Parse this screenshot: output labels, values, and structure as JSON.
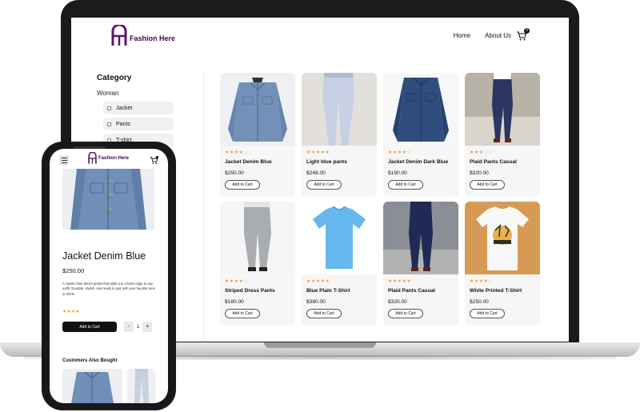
{
  "brand": {
    "name": "Fashion Here",
    "primary_color": "#3a0a4a",
    "accent_color": "#e6a23c"
  },
  "nav": {
    "links": [
      "Home",
      "About Us"
    ],
    "cart_count": "0"
  },
  "sidebar": {
    "title": "Category",
    "group": "Woman",
    "items": [
      "Jacket",
      "Pants",
      "T-shirt"
    ]
  },
  "products": [
    {
      "name": "Jacket Denim Blue",
      "price": "$250.00",
      "rating": 4,
      "button": "Add to Cart",
      "image": "denim-jacket-light"
    },
    {
      "name": "Light blue pants",
      "price": "$248.00",
      "rating": 5,
      "button": "Add to Cart",
      "image": "light-blue-pants"
    },
    {
      "name": "Jacket Denim Dark Blue",
      "price": "$190.00",
      "rating": 4,
      "button": "Add to Cart",
      "image": "denim-jacket-dark"
    },
    {
      "name": "Plaid Pants Casual",
      "price": "$320.00",
      "rating": 3,
      "button": "Add to Cart",
      "image": "plaid-pants-street"
    },
    {
      "name": "Striped Dress Pants",
      "price": "$180.00",
      "rating": 4,
      "button": "Add to Cart",
      "image": "grey-dress-pants"
    },
    {
      "name": "Blue Plain T-Shirt",
      "price": "$380.00",
      "rating": 5,
      "button": "Add to Cart",
      "image": "blue-tshirt"
    },
    {
      "name": "Plaid Pants Casual",
      "price": "$320.00",
      "rating": 5,
      "button": "Add to Cart",
      "image": "navy-pants-street"
    },
    {
      "name": "White Printed T-Shirt",
      "price": "$250.00",
      "rating": 4,
      "button": "Add to Cart",
      "image": "white-printed-tshirt"
    }
  ],
  "phone": {
    "logo": "Fashion Here",
    "cart_count": "0",
    "product_title": "Jacket Denim Blue",
    "price": "$250.00",
    "description": "A classic blue denim jacket that adds a la d-back edge to any outfit. Durable, stylish, and ready to pair with your favorite tees or shirts.",
    "rating": 4,
    "add_button": "Add to Cart",
    "qty_minus": "-",
    "qty_value": "1",
    "qty_plus": "+",
    "also_bought": "Customers Also Bought"
  }
}
